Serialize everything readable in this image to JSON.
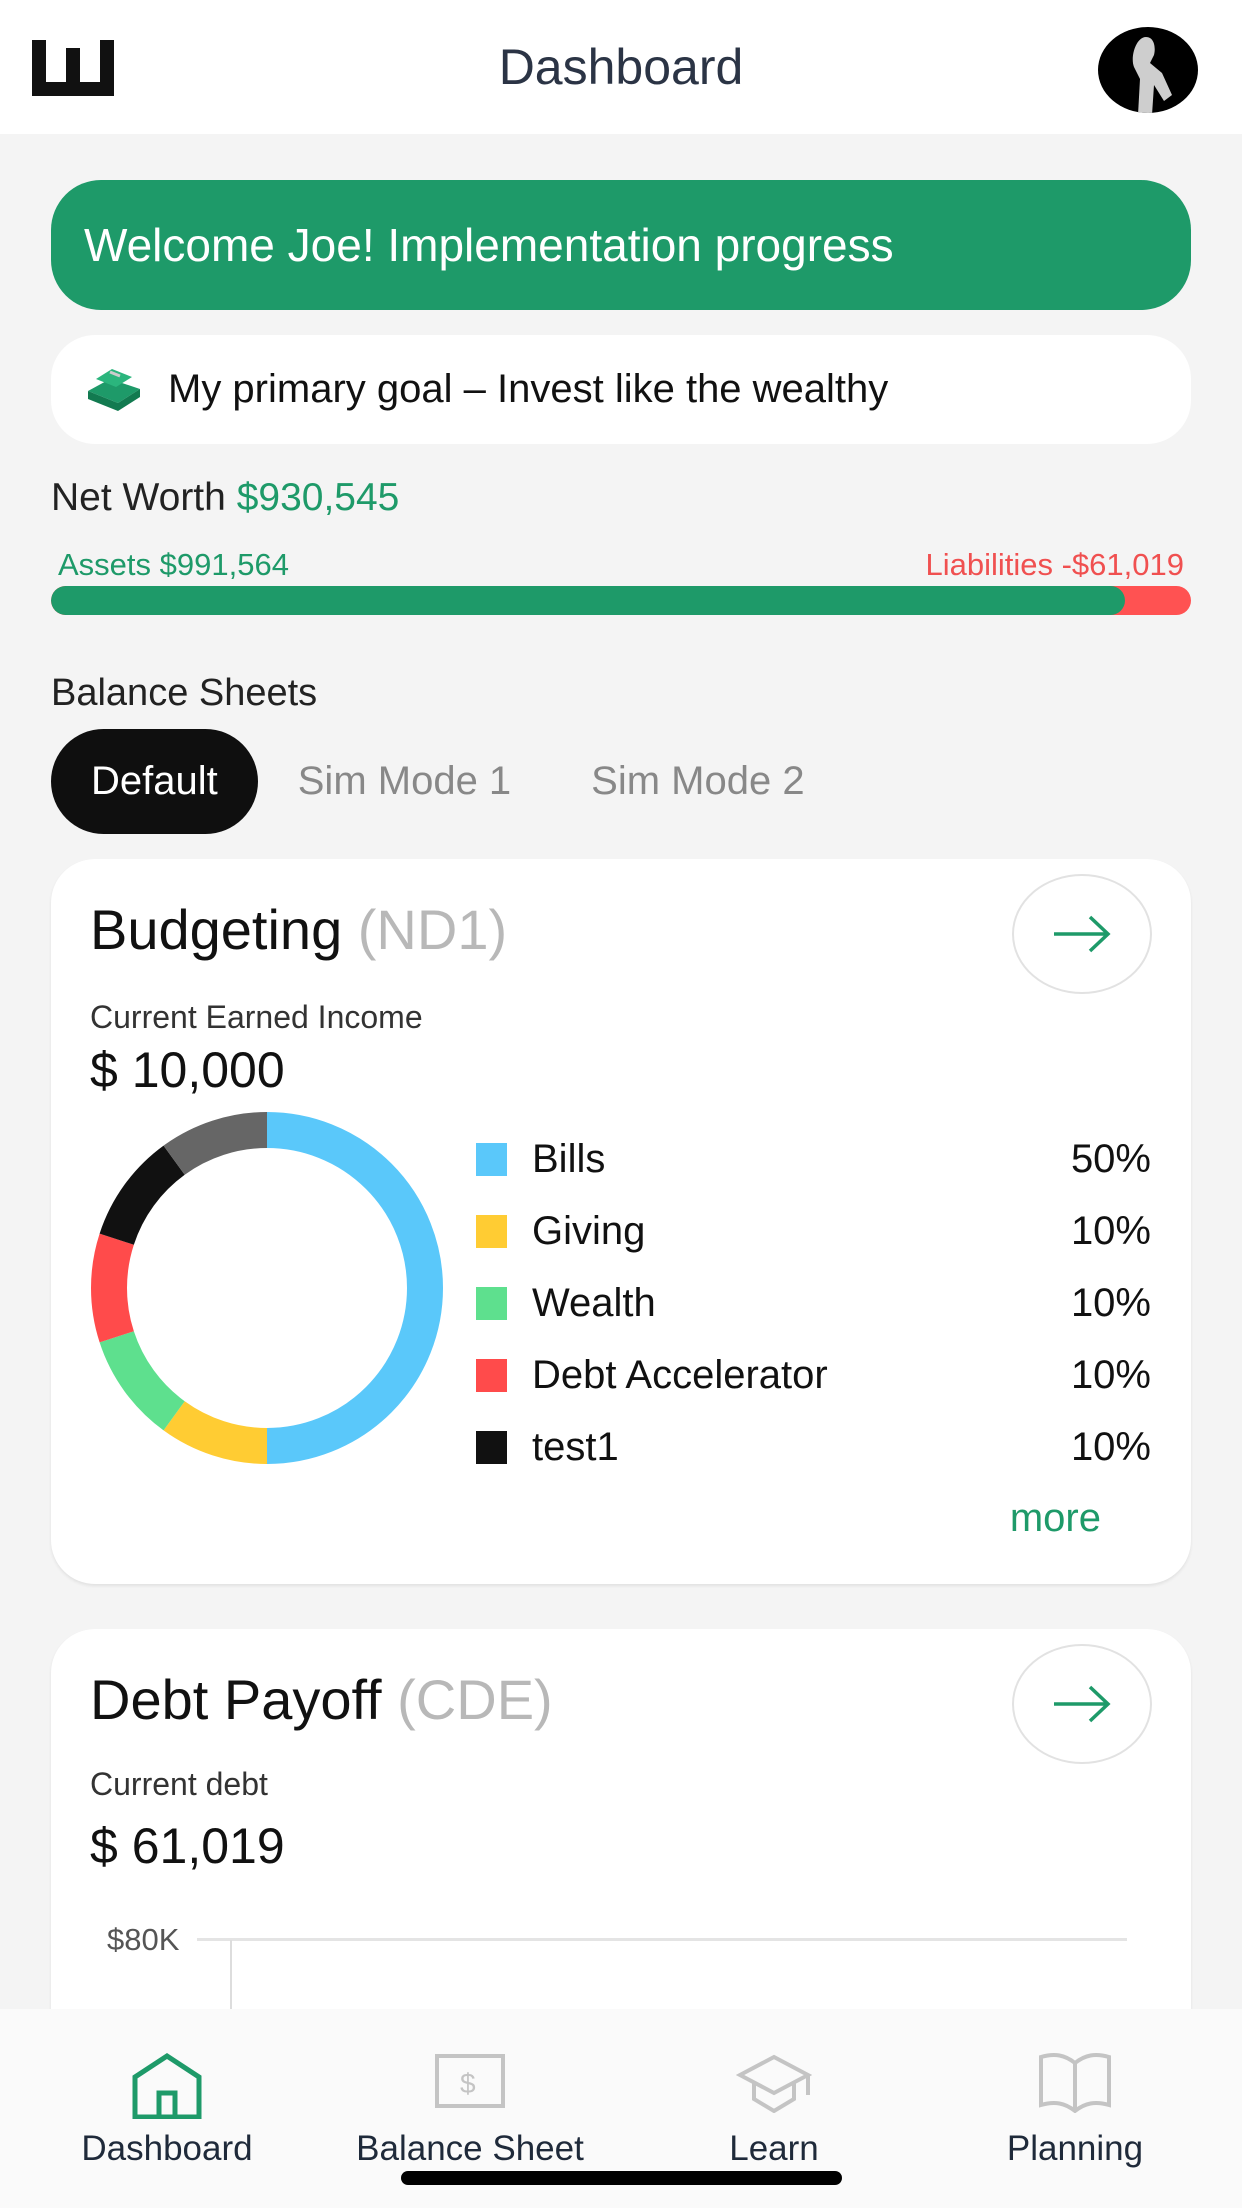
{
  "header": {
    "title": "Dashboard",
    "logo_icon": "w-logo-icon",
    "avatar_icon": "user-avatar"
  },
  "banner": {
    "text": "Welcome Joe! Implementation progress"
  },
  "goal": {
    "icon": "money-stack-icon",
    "text": "My primary goal  –  Invest like the wealthy"
  },
  "net_worth": {
    "label": "Net Worth",
    "value": "$930,545",
    "assets_label": "Assets $991,564",
    "liabilities_label": "Liabilities -$61,019",
    "assets_fraction": 0.942
  },
  "balance_sheets": {
    "label": "Balance Sheets",
    "tabs": [
      {
        "label": "Default",
        "active": true
      },
      {
        "label": "Sim Mode 1",
        "active": false
      },
      {
        "label": "Sim Mode 2",
        "active": false
      }
    ]
  },
  "budgeting": {
    "title": "Budgeting",
    "code": "(ND1)",
    "income_label": "Current Earned Income",
    "income_value": "$ 10,000",
    "items": [
      {
        "label": "Bills",
        "percent": "50%",
        "value": 50,
        "color": "#5ac8fa"
      },
      {
        "label": "Giving",
        "percent": "10%",
        "value": 10,
        "color": "#ffcc33"
      },
      {
        "label": "Wealth",
        "percent": "10%",
        "value": 10,
        "color": "#5ee08e"
      },
      {
        "label": "Debt Accelerator",
        "percent": "10%",
        "value": 10,
        "color": "#ff4b4b"
      },
      {
        "label": "test1",
        "percent": "10%",
        "value": 10,
        "color": "#111111"
      }
    ],
    "other_color": "#666666",
    "more_label": "more"
  },
  "debt": {
    "title": "Debt Payoff",
    "code": "(CDE)",
    "debt_label": "Current debt",
    "debt_value": "$ 61,019",
    "y_tick": "$80K"
  },
  "nav": [
    {
      "label": "Dashboard",
      "icon": "home-icon",
      "active": true
    },
    {
      "label": "Balance Sheet",
      "icon": "balance-sheet-icon",
      "active": false
    },
    {
      "label": "Learn",
      "icon": "graduation-cap-icon",
      "active": false
    },
    {
      "label": "Planning",
      "icon": "book-icon",
      "active": false
    }
  ],
  "colors": {
    "accent": "#1e9a69",
    "liability": "#ff5252"
  }
}
